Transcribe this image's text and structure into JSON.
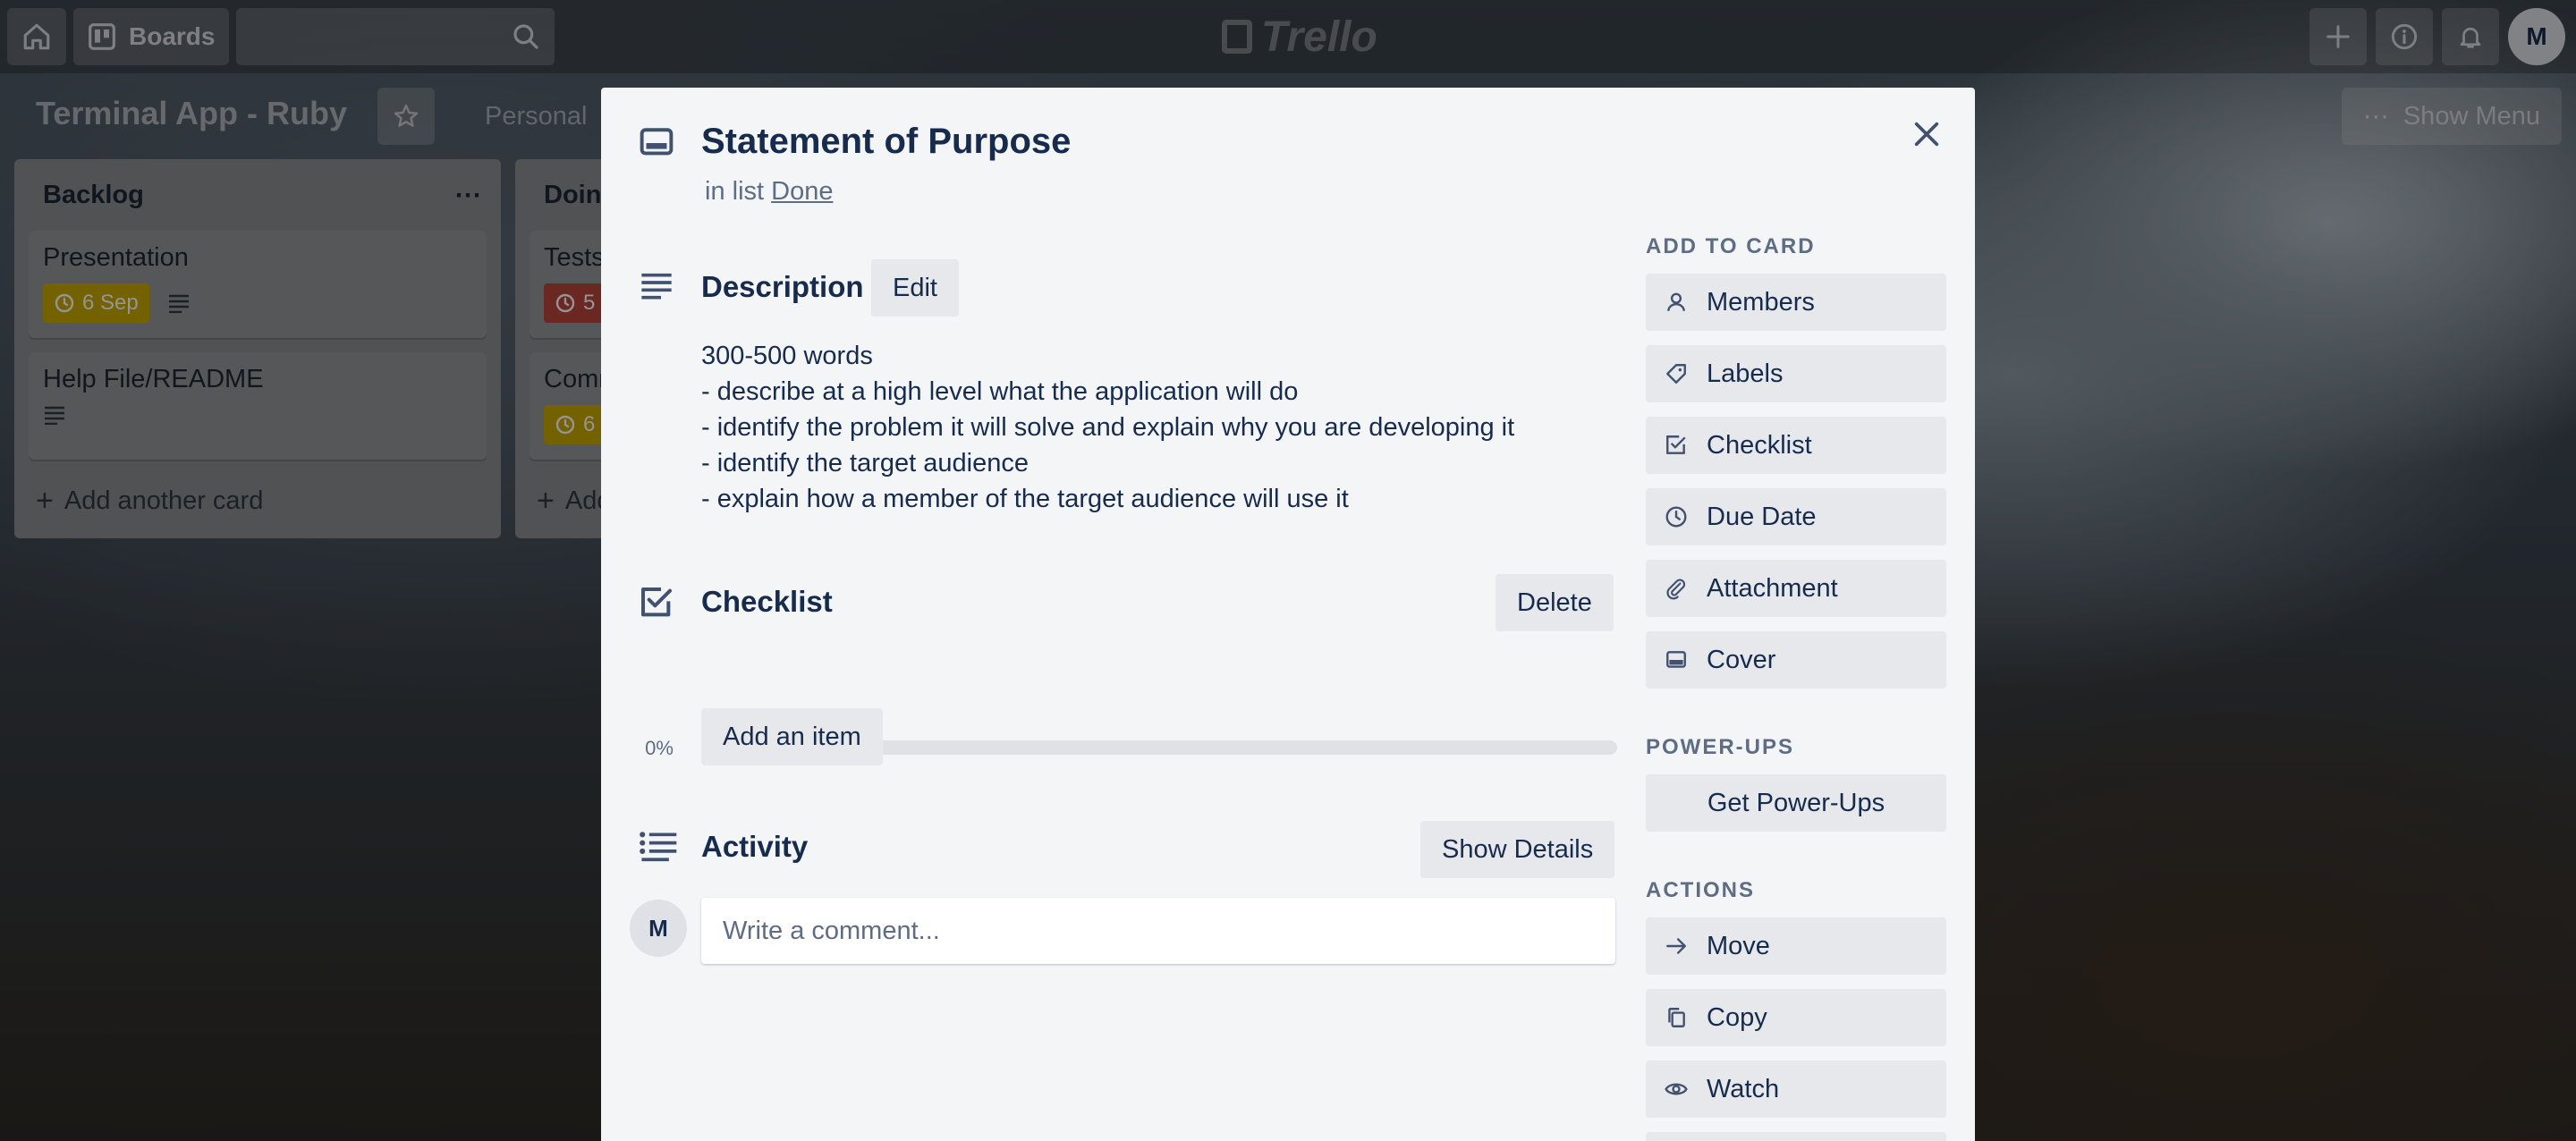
{
  "header": {
    "boards_label": "Boards",
    "logo_text": "Trello",
    "avatar_initial": "M"
  },
  "board": {
    "title": "Terminal App - Ruby",
    "visibility": "Personal",
    "show_menu_label": "Show Menu"
  },
  "lists": [
    {
      "title": "Backlog",
      "cards": [
        {
          "title": "Presentation",
          "due": "6 Sep",
          "due_color": "#f2d600",
          "has_description": true
        },
        {
          "title": "Help File/README",
          "due": "",
          "has_description": true
        }
      ],
      "add_card_label": "Add another card"
    },
    {
      "title": "Doing",
      "cards": [
        {
          "title": "Tests",
          "due": "5",
          "due_color": "#eb5a46"
        },
        {
          "title": "Comm",
          "due": "6",
          "due_color": "#f2d600"
        }
      ],
      "add_card_label": "Add"
    }
  ],
  "card_detail": {
    "title": "Statement of Purpose",
    "in_list_prefix": "in list",
    "list_name": "Done",
    "description": {
      "heading": "Description",
      "edit_label": "Edit",
      "lines": [
        "300-500 words",
        "- describe at a high level what the application will do",
        "- identify the problem it will solve and explain why you are developing it",
        "- identify the target audience",
        "- explain how a member of the target audience will use it"
      ]
    },
    "checklist": {
      "heading": "Checklist",
      "delete_label": "Delete",
      "progress_text": "0%",
      "progress": 0,
      "add_item_label": "Add an item"
    },
    "activity": {
      "heading": "Activity",
      "show_details_label": "Show Details",
      "avatar_initial": "M",
      "comment_placeholder": "Write a comment..."
    }
  },
  "sidebar": {
    "add_to_card_heading": "ADD TO CARD",
    "add_to_card": [
      {
        "label": "Members",
        "icon": "person-icon"
      },
      {
        "label": "Labels",
        "icon": "tag-icon"
      },
      {
        "label": "Checklist",
        "icon": "checklist-icon"
      },
      {
        "label": "Due Date",
        "icon": "clock-icon"
      },
      {
        "label": "Attachment",
        "icon": "paperclip-icon"
      },
      {
        "label": "Cover",
        "icon": "card-cover-icon"
      }
    ],
    "power_ups_heading": "POWER-UPS",
    "get_power_ups_label": "Get Power-Ups",
    "actions_heading": "ACTIONS",
    "actions": [
      {
        "label": "Move",
        "icon": "arrow-right-icon"
      },
      {
        "label": "Copy",
        "icon": "copy-icon"
      },
      {
        "label": "Watch",
        "icon": "eye-icon"
      }
    ]
  }
}
